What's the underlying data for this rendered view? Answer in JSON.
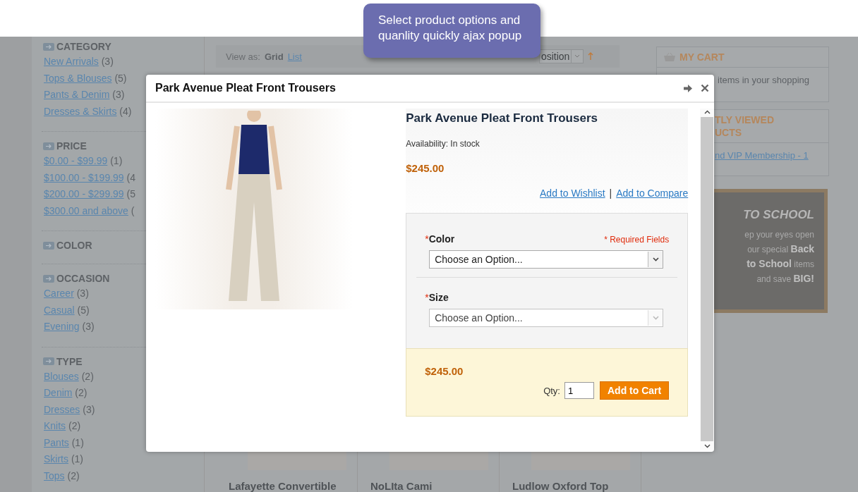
{
  "tooltip": {
    "text": "Select product options and quanlity quickly ajax popup"
  },
  "sidebar": {
    "sections": [
      {
        "title": "CATEGORY",
        "items": [
          {
            "label": "New Arrivals",
            "count": "(3)"
          },
          {
            "label": "Tops & Blouses",
            "count": "(5)"
          },
          {
            "label": "Pants & Denim",
            "count": "(3)"
          },
          {
            "label": "Dresses & Skirts",
            "count": "(4)"
          }
        ]
      },
      {
        "title": "PRICE",
        "items": [
          {
            "label": "$0.00 - $99.99",
            "count": "(1)"
          },
          {
            "label": "$100.00 - $199.99",
            "count": "(4"
          },
          {
            "label": "$200.00 - $299.99",
            "count": "(5"
          },
          {
            "label": "$300.00 and above",
            "count": "("
          }
        ]
      },
      {
        "title": "COLOR"
      },
      {
        "title": "OCCASION",
        "items": [
          {
            "label": "Career",
            "count": "(3)"
          },
          {
            "label": "Casual",
            "count": "(5)"
          },
          {
            "label": "Evening",
            "count": "(3)"
          }
        ]
      },
      {
        "title": "TYPE",
        "items": [
          {
            "label": "Blouses",
            "count": "(2)"
          },
          {
            "label": "Denim",
            "count": "(2)"
          },
          {
            "label": "Dresses",
            "count": "(3)"
          },
          {
            "label": "Knits",
            "count": "(2)"
          },
          {
            "label": "Pants",
            "count": "(1)"
          },
          {
            "label": "Skirts",
            "count": "(1)"
          },
          {
            "label": "Tops",
            "count": "(2)"
          }
        ]
      }
    ]
  },
  "toolbar": {
    "view_as_label": "View as:",
    "view_modes": [
      {
        "label": "Grid",
        "selected": true
      },
      {
        "label": "List",
        "selected": false
      }
    ],
    "sort_value": "osition"
  },
  "products": [
    {
      "name": "Lafayette Convertible"
    },
    {
      "name": "NoLIta Cami"
    },
    {
      "name": "Ludlow Oxford Top"
    }
  ],
  "cart": {
    "title": "MY CART",
    "text": "items in your shopping"
  },
  "recently_viewed": {
    "title_lines": [
      "TLY VIEWED",
      "UCTS"
    ],
    "link": "nd VIP Membership - 1"
  },
  "banner": {
    "heading": "TO SCHOOL",
    "lines": [
      "ep your eyes open",
      "our special **Back**",
      "**to School** items",
      "and save **BIG!**"
    ]
  },
  "modal": {
    "title": "Park Avenue Pleat Front Trousers",
    "product_name": "Park Avenue Pleat Front Trousers",
    "availability": "Availability: In stock",
    "price": "$245.00",
    "links": [
      "Add to Wishlist",
      "Add to Compare"
    ],
    "separator": "|",
    "required_note": "* Required Fields",
    "required_mark": "*",
    "options": [
      {
        "label": "Color",
        "required": true,
        "value": "Choose an Option...",
        "disabled": false
      },
      {
        "label": "Size",
        "required": true,
        "value": "Choose an Option...",
        "disabled": true
      }
    ],
    "total_price": "$245.00",
    "qty_label": "Qty:",
    "qty": "1",
    "add_button": "Add to Cart"
  }
}
